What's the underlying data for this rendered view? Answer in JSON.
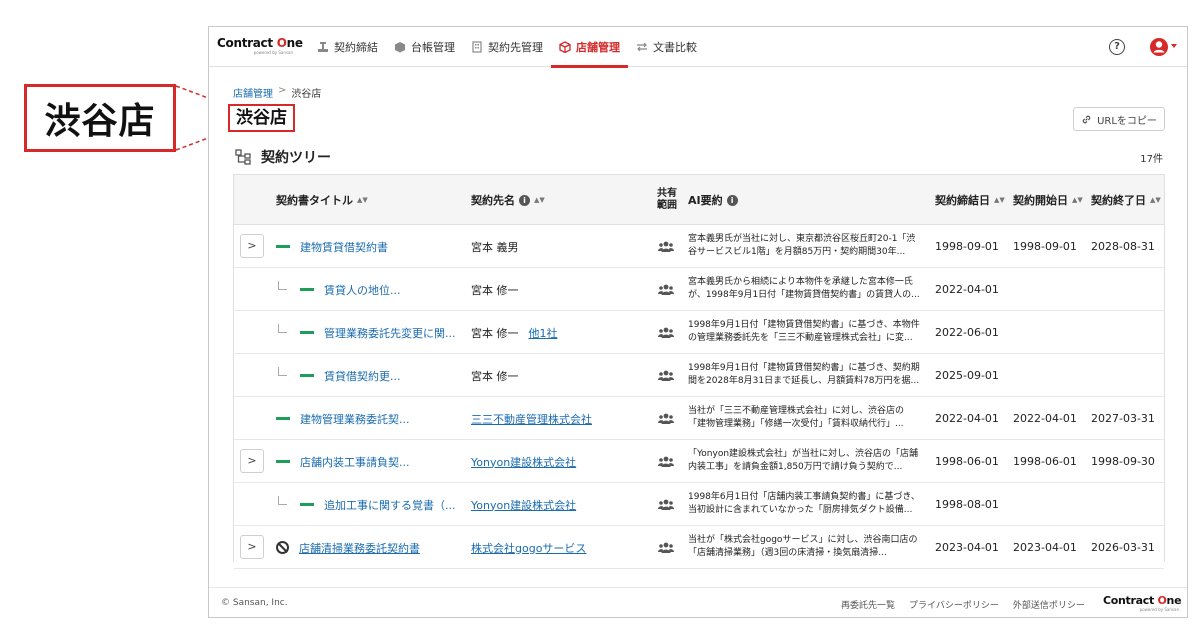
{
  "callout": {
    "label": "渋谷店"
  },
  "header": {
    "logo_text_a": "Contract ",
    "logo_text_o": "O",
    "logo_text_b": "ne",
    "logo_sub": "powered by Sansan",
    "nav": [
      {
        "label": "契約締結",
        "icon": "contract-sign-icon"
      },
      {
        "label": "台帳管理",
        "icon": "ledger-icon"
      },
      {
        "label": "契約先管理",
        "icon": "building-icon"
      },
      {
        "label": "店舗管理",
        "icon": "store-box-icon",
        "active": true
      },
      {
        "label": "文書比較",
        "icon": "compare-arrows-icon"
      }
    ],
    "help": "?"
  },
  "breadcrumb": {
    "parent": "店舗管理",
    "separator": ">",
    "current": "渋谷店"
  },
  "page_title": "渋谷店",
  "copy_url_label": "URLをコピー",
  "section": {
    "title": "契約ツリー",
    "count": "17件"
  },
  "table": {
    "headers": {
      "title": "契約書タイトル",
      "party": "契約先名",
      "shared_line1": "共有",
      "shared_line2": "範囲",
      "ai": "AI要約",
      "signed": "契約締結日",
      "start": "契約開始日",
      "end": "契約終了日"
    },
    "rows": [
      {
        "level": 0,
        "expand": true,
        "marker": "dash",
        "title": "建物賃貸借契約書",
        "party": "宮本 義男",
        "party_link": false,
        "party_extra": "",
        "ai": "宮本義男氏が当社に対し、東京都渋谷区桜丘町20-1「渋谷サービスビル1階」を月額85万円・契約期間30年...",
        "signed": "1998-09-01",
        "start": "1998-09-01",
        "end": "2028-08-31"
      },
      {
        "level": 1,
        "expand": false,
        "marker": "dash",
        "title": "賃貸人の地位...",
        "party": "宮本 修一",
        "party_link": false,
        "party_extra": "",
        "ai": "宮本義男氏から相続により本物件を承継した宮本修一氏が、1998年9月1日付「建物賃貸借契約書」の賃貸人の...",
        "signed": "2022-04-01",
        "start": "",
        "end": ""
      },
      {
        "level": 1,
        "expand": false,
        "marker": "dash",
        "title": "管理業務委託先変更に関...",
        "party": "宮本 修一",
        "party_link": false,
        "party_extra": "他1社",
        "ai": "1998年9月1日付「建物賃貸借契約書」に基づき、本物件の管理業務委託先を「三三不動産管理株式会社」に変...",
        "signed": "2022-06-01",
        "start": "",
        "end": ""
      },
      {
        "level": 1,
        "expand": false,
        "marker": "dash",
        "title": "賃貸借契約更...",
        "party": "宮本 修一",
        "party_link": false,
        "party_extra": "",
        "ai": "1998年9月1日付「建物賃貸借契約書」に基づき、契約期間を2028年8月31日まで延長し、月額賃料78万円を据...",
        "signed": "2025-09-01",
        "start": "",
        "end": ""
      },
      {
        "level": 0,
        "expand": false,
        "marker": "dash",
        "title": "建物管理業務委託契...",
        "party": "三三不動産管理株式会社",
        "party_link": true,
        "party_extra": "",
        "ai": "当社が「三三不動産管理株式会社」に対し、渋谷店の「建物管理業務」「修繕一次受付」「賃料収納代行」...",
        "signed": "2022-04-01",
        "start": "2022-04-01",
        "end": "2027-03-31"
      },
      {
        "level": 0,
        "expand": true,
        "marker": "dash",
        "title": "店舗内装工事請負契...",
        "party": "Yonyon建設株式会社",
        "party_link": true,
        "party_extra": "",
        "ai": "「Yonyon建設株式会社」が当社に対し、渋谷店の「店舗内装工事」を請負金額1,850万円で請け負う契約で...",
        "signed": "1998-06-01",
        "start": "1998-06-01",
        "end": "1998-09-30"
      },
      {
        "level": 1,
        "expand": false,
        "marker": "dash",
        "title": "追加工事に関する覚書（...",
        "party": "Yonyon建設株式会社",
        "party_link": true,
        "party_extra": "",
        "ai": "1998年6月1日付「店舗内装工事請負契約書」に基づき、当初設計に含まれていなかった「厨房排気ダクト設備...",
        "signed": "1998-08-01",
        "start": "",
        "end": ""
      },
      {
        "level": 0,
        "expand": true,
        "marker": "no",
        "title": "店舗清掃業務委託契約書",
        "party": "株式会社gogoサービス",
        "party_link": true,
        "party_extra": "",
        "ai": "当社が「株式会社gogoサービス」に対し、渋谷南口店の「店舗清掃業務」（週3回の床清掃・換気扇清掃...",
        "signed": "2023-04-01",
        "start": "2023-04-01",
        "end": "2026-03-31"
      }
    ]
  },
  "footer": {
    "copyright": "© Sansan, Inc.",
    "links": [
      "再委託先一覧",
      "プライバシーポリシー",
      "外部送信ポリシー"
    ]
  },
  "colors": {
    "accent": "#d62a2a",
    "link": "#1a6bb0",
    "tree_marker": "#1e9e5a"
  }
}
